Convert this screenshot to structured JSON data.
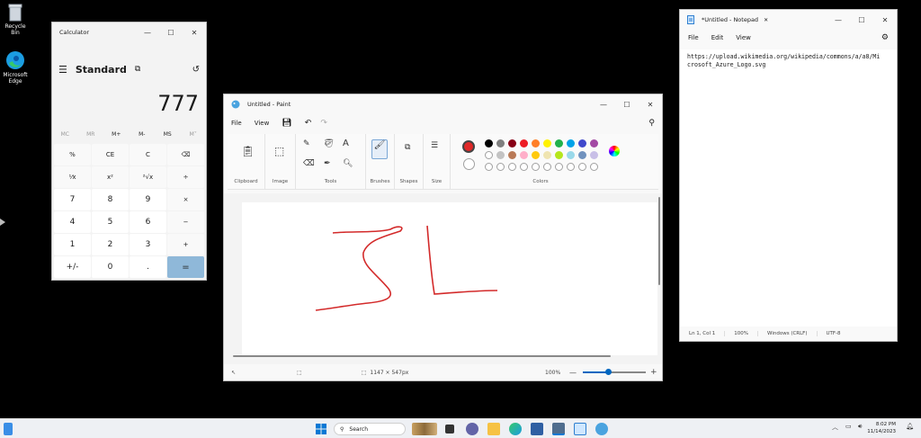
{
  "desktop": {
    "recycle_bin_label": "Recycle Bin",
    "edge_label": "Microsoft Edge"
  },
  "calculator": {
    "title": "Calculator",
    "mode": "Standard",
    "display": "777",
    "memory": [
      "MC",
      "MR",
      "M+",
      "M-",
      "MS",
      "M˅"
    ],
    "keys": [
      "%",
      "CE",
      "C",
      "⌫",
      "¹⁄x",
      "x²",
      "²√x",
      "÷",
      "7",
      "8",
      "9",
      "×",
      "4",
      "5",
      "6",
      "−",
      "1",
      "2",
      "3",
      "+",
      "+/-",
      "0",
      ".",
      "="
    ]
  },
  "paint": {
    "title": "Untitled - Paint",
    "menu": {
      "file": "File",
      "view": "View"
    },
    "groups": {
      "clipboard": "Clipboard",
      "image": "Image",
      "tools": "Tools",
      "brushes": "Brushes",
      "shapes": "Shapes",
      "size": "Size",
      "colors": "Colors"
    },
    "status": {
      "dimensions": "1147 × 547px",
      "zoom": "100%"
    },
    "zoom_fraction": 0.4,
    "palette_row1": [
      "#000000",
      "#7f7f7f",
      "#880015",
      "#ed1c24",
      "#ff7f27",
      "#fff200",
      "#22b14c",
      "#00a2e8",
      "#3f48cc",
      "#a349a4"
    ],
    "palette_row2": [
      "#ffffff",
      "#c3c3c3",
      "#b97a57",
      "#ffaec9",
      "#ffc90e",
      "#efe4b0",
      "#b5e61d",
      "#99d9ea",
      "#7092be",
      "#c8bfe7"
    ],
    "primary_color": "#e02828"
  },
  "notepad": {
    "title": "*Untitled - Notepad",
    "menu": {
      "file": "File",
      "edit": "Edit",
      "view": "View"
    },
    "content": "https://upload.wikimedia.org/wikipedia/commons/a/a8/Mi\ncrosoft_Azure_Logo.svg",
    "status": {
      "position": "Ln 1, Col 1",
      "zoom": "100%",
      "line_endings": "Windows (CRLF)",
      "encoding": "UTF-8"
    }
  },
  "taskbar": {
    "search_placeholder": "Search",
    "time": "8:02 PM",
    "date": "11/14/2023"
  }
}
